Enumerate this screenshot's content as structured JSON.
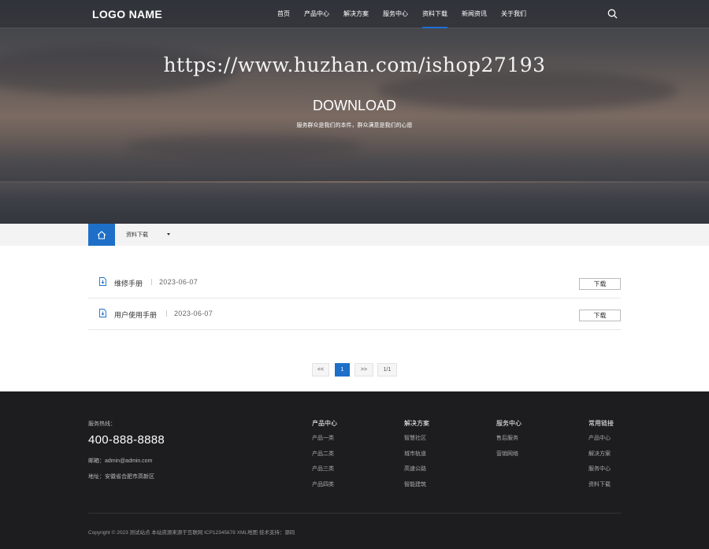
{
  "nav": {
    "logo": "LOGO NAME",
    "items": [
      {
        "label": "首页"
      },
      {
        "label": "产品中心"
      },
      {
        "label": "解决方案"
      },
      {
        "label": "服务中心"
      },
      {
        "label": "资料下载"
      },
      {
        "label": "新闻资讯"
      },
      {
        "label": "关于我们"
      }
    ],
    "active_index": 4
  },
  "hero": {
    "watermark": "https://www.huzhan.com/ishop27193",
    "title": "DOWNLOAD",
    "subtitle": "服务群众是我们的本件，群众满意是我们的心愿"
  },
  "breadcrumb": {
    "current": "资料下载"
  },
  "downloads": [
    {
      "name": "维修手册",
      "date": "2023-06-07",
      "button": "下载"
    },
    {
      "name": "用户使用手册",
      "date": "2023-06-07",
      "button": "下载"
    }
  ],
  "pagination": {
    "prev": "<<",
    "current": "1",
    "next": ">>",
    "info": "1/1"
  },
  "footer": {
    "hotline_label": "服务热线：",
    "phone": "400-888-8888",
    "email": "邮箱：admin@admin.com",
    "address": "地址：安徽省合肥市高新区",
    "columns": [
      {
        "title": "产品中心",
        "links": [
          "产品一类",
          "产品二类",
          "产品三类",
          "产品四类"
        ]
      },
      {
        "title": "解决方案",
        "links": [
          "智慧社区",
          "城市轨道",
          "高速公路",
          "智能建筑"
        ]
      },
      {
        "title": "服务中心",
        "links": [
          "售后服务",
          "营销网络"
        ]
      },
      {
        "title": "常用链接",
        "links": [
          "产品中心",
          "解决方案",
          "服务中心",
          "资料下载"
        ]
      }
    ],
    "copyright": "Copyright © 2023 测试站点 本站资源来源于互联网  ICP12345678  XML地图  技术支持：源码"
  },
  "colors": {
    "accent": "#1e6fc8",
    "footer_bg": "#1d1d1f"
  }
}
